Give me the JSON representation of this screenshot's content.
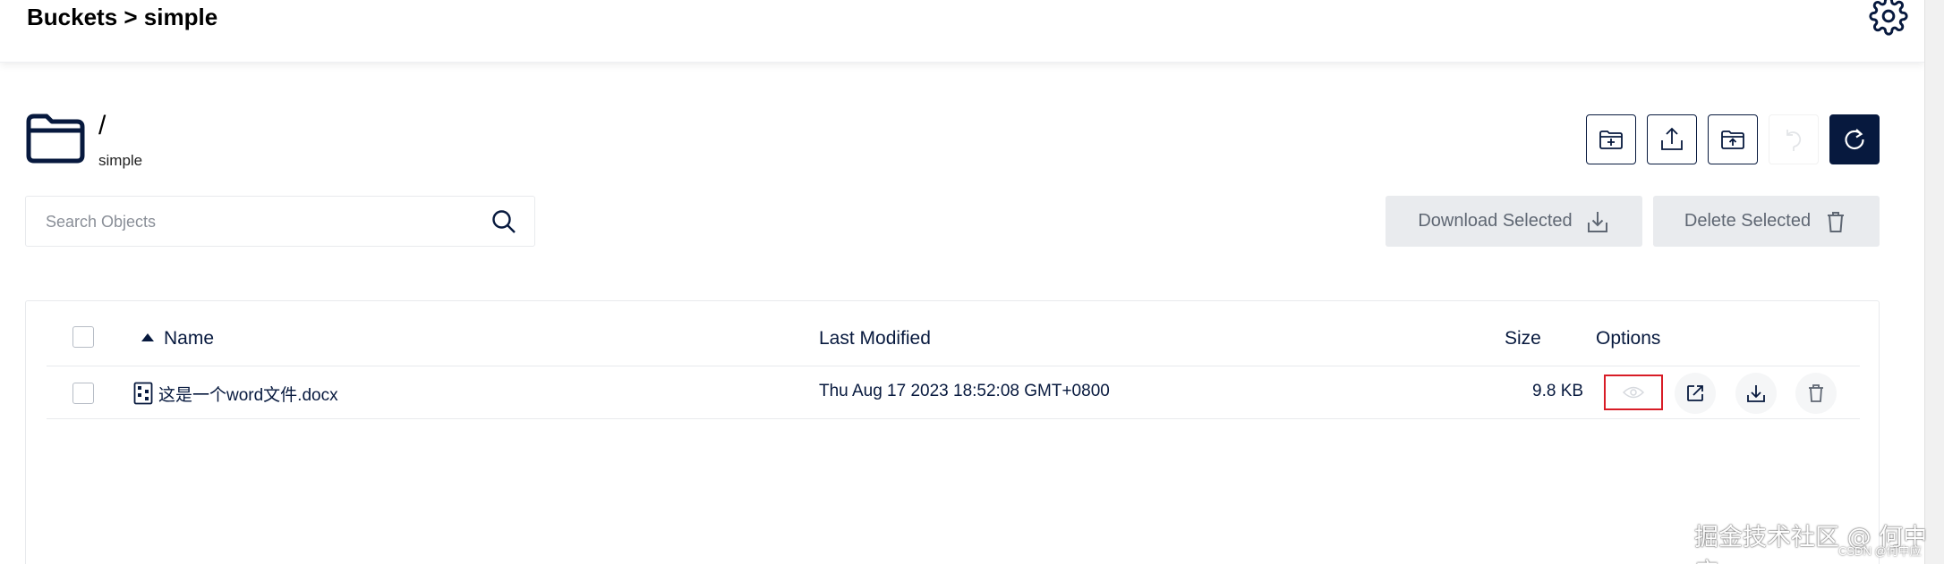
{
  "breadcrumb": {
    "text": "Buckets > simple"
  },
  "path": {
    "current": "/",
    "bucket": "simple"
  },
  "toolbar": {
    "icons": [
      "new-folder-icon",
      "upload-file-icon",
      "upload-folder-icon",
      "rewind-icon",
      "refresh-icon"
    ]
  },
  "search": {
    "placeholder": "Search Objects",
    "value": ""
  },
  "actions": {
    "download_selected": "Download Selected",
    "delete_selected": "Delete Selected"
  },
  "table": {
    "columns": {
      "name": "Name",
      "last_modified": "Last Modified",
      "size": "Size",
      "options": "Options"
    },
    "rows": [
      {
        "name": "这是一个word文件.docx",
        "last_modified": "Thu Aug 17 2023 18:52:08 GMT+0800",
        "size": "9.8 KB"
      }
    ]
  },
  "watermark": {
    "main": "掘金技术社区 @ 何中应",
    "sub": "CSDN @何中应"
  },
  "colors": {
    "primary": "#07193e",
    "highlight": "#d81c26",
    "disabled_bg": "#e9ebee"
  }
}
